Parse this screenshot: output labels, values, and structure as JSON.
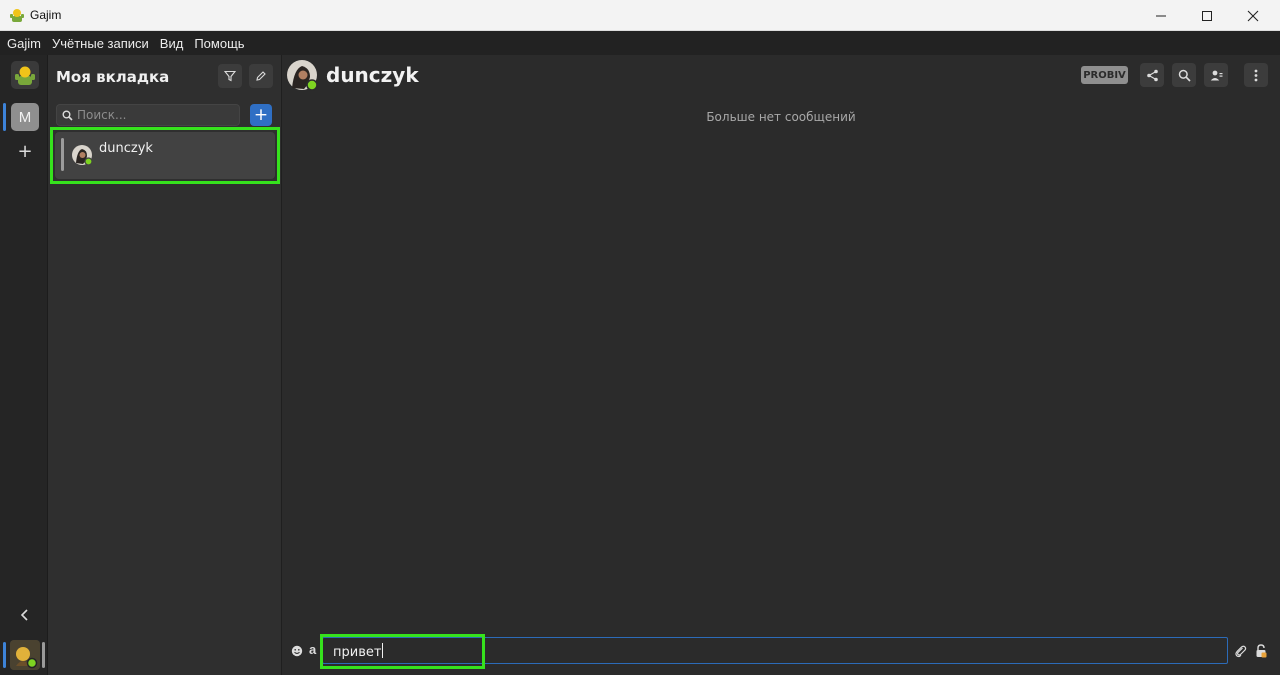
{
  "window": {
    "title": "Gajim"
  },
  "menubar": {
    "items": [
      "Gajim",
      "Учётные записи",
      "Вид",
      "Помощь"
    ]
  },
  "rail": {
    "workspace_letter": "M",
    "add_glyph": "+"
  },
  "chat_list": {
    "workspace_title": "Моя вкладка",
    "search_placeholder": "Поиск...",
    "add_glyph": "+",
    "contacts": [
      {
        "name": "dunczyk",
        "status": "online",
        "selected": true
      }
    ]
  },
  "chat": {
    "contact_name": "dunczyk",
    "encryption_badge": "PROBIV",
    "empty_notice": "Больше нет сообщений",
    "composer_text": "привет",
    "format_glyph": "a"
  },
  "colors": {
    "accent": "#2f6fc4",
    "online": "#7ed321",
    "highlight": "#36e21d"
  },
  "icons": [
    "gajim-logo-icon",
    "minimize-icon",
    "maximize-icon",
    "close-icon",
    "filter-icon",
    "edit-icon",
    "search-icon",
    "chevron-left-icon",
    "share-icon",
    "contact-details-icon",
    "more-vertical-icon",
    "emoji-icon",
    "attach-icon",
    "lock-icon"
  ]
}
